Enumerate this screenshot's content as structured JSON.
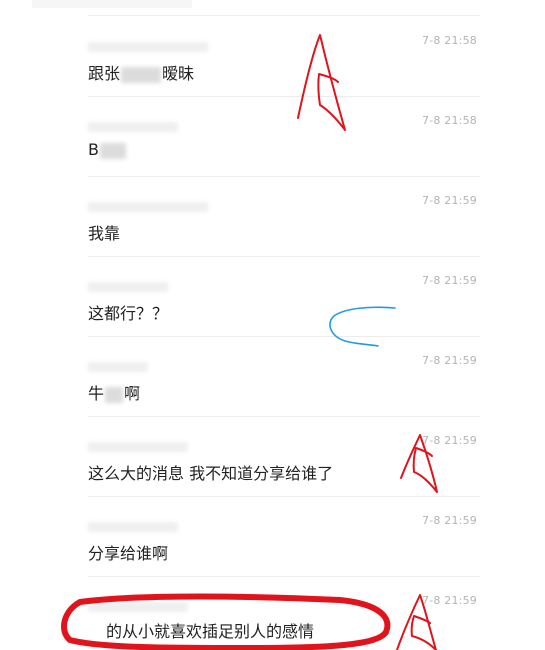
{
  "messages": [
    {
      "time": "7-8 21:58",
      "text_before": "跟张",
      "text_after": "暧昧"
    },
    {
      "time": "7-8 21:58",
      "text_before": "B",
      "text_after": ""
    },
    {
      "time": "7-8 21:59",
      "text_before": "我靠",
      "text_after": ""
    },
    {
      "time": "7-8 21:59",
      "text_before": "这都行？？",
      "text_after": ""
    },
    {
      "time": "7-8 21:59",
      "text_before": "牛",
      "text_after": "啊"
    },
    {
      "time": "7-8 21:59",
      "text_before": "这么大的消息 我不知道分享给谁了",
      "text_after": ""
    },
    {
      "time": "7-8 21:59",
      "text_before": "分享给谁啊",
      "text_after": ""
    },
    {
      "time": "7-8 21:59",
      "text_before": "的从小就喜欢插足别人的感情",
      "text_after": ""
    }
  ],
  "annotation_colors": {
    "red": "#e0141c",
    "blue": "#1e9be0"
  }
}
